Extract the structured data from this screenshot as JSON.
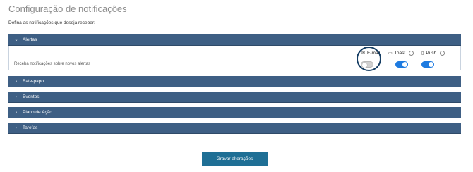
{
  "page": {
    "title": "Configuração de notificações",
    "subtitle": "Defina as notificações que deseja receber:"
  },
  "sections": [
    {
      "label": "Alertas",
      "expanded": true
    },
    {
      "label": "Bate-papo",
      "expanded": false
    },
    {
      "label": "Eventos",
      "expanded": false
    },
    {
      "label": "Plano de Ação",
      "expanded": false
    },
    {
      "label": "Tarefas",
      "expanded": false
    }
  ],
  "alertas": {
    "description": "Receba notificações sobre novos alertas",
    "channels": [
      {
        "label": "E-mail",
        "icon": "envelope-icon",
        "enabled": false,
        "highlighted": true
      },
      {
        "label": "Toast",
        "icon": "monitor-icon",
        "enabled": true
      },
      {
        "label": "Push",
        "icon": "phone-icon",
        "enabled": true
      }
    ]
  },
  "actions": {
    "save_label": "Gravar alterações"
  },
  "colors": {
    "panel": "#3e5f84",
    "toggle_on": "#1e7be0",
    "save_button": "#1f6f95"
  }
}
